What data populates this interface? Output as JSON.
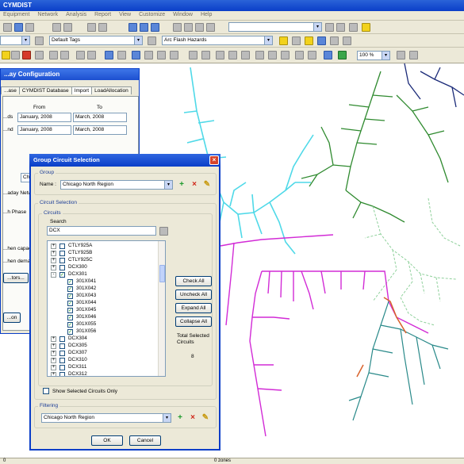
{
  "app": {
    "title": "CYMDIST",
    "menu": [
      "Equipment",
      "Network",
      "Analysis",
      "Report",
      "View",
      "Customize",
      "Window",
      "Help"
    ]
  },
  "toolbar": {
    "tags_combo": "Default Tags",
    "hazard_combo": "Arc Flash Hazards",
    "zoom_combo": "100 %"
  },
  "background_dialog": {
    "title": "...ay Configuration",
    "tabs": [
      "...ase",
      "CYMDIST Database",
      "Import",
      "LoadAllocation"
    ],
    "from_label": "From",
    "to_label": "To",
    "row1_label": "...ds",
    "row2_label": "...nd",
    "row1_from": "January, 2008",
    "row1_to": "March, 2008",
    "row2_from": "January, 2008",
    "row2_to": "March, 2008",
    "chica_field": "Chica...",
    "network_label": "...aday Network",
    "phase_label": "...h Phase",
    "capacity_label": "...hen capacity",
    "demands_label": "...hen demands",
    "tors_button": "...tors...",
    "bottom_button": "...on"
  },
  "dialog": {
    "title": "Group Circuit Selection",
    "group_label": "Group",
    "name_label": "Name :",
    "name_value": "Chicago North Region",
    "circuit_selection_label": "Circuit Selection",
    "circuits_label": "Circuits",
    "search_label": "Search",
    "search_value": "DCX",
    "tree": [
      {
        "label": "CTLY925A",
        "expander": "+",
        "checked": false,
        "indent": 0
      },
      {
        "label": "CTLY925B",
        "expander": "+",
        "checked": false,
        "indent": 0
      },
      {
        "label": "CTLY925C",
        "expander": "+",
        "checked": false,
        "indent": 0
      },
      {
        "label": "DCX300",
        "expander": "+",
        "checked": false,
        "indent": 0
      },
      {
        "label": "DCX301",
        "expander": "-",
        "checked": true,
        "indent": 0
      },
      {
        "label": "301X041",
        "expander": "",
        "checked": true,
        "indent": 1
      },
      {
        "label": "301X042",
        "expander": "",
        "checked": true,
        "indent": 1
      },
      {
        "label": "301X043",
        "expander": "",
        "checked": true,
        "indent": 1
      },
      {
        "label": "301X044",
        "expander": "",
        "checked": true,
        "indent": 1
      },
      {
        "label": "301X045",
        "expander": "",
        "checked": true,
        "indent": 1
      },
      {
        "label": "301X046",
        "expander": "",
        "checked": true,
        "indent": 1
      },
      {
        "label": "301X055",
        "expander": "",
        "checked": true,
        "indent": 1
      },
      {
        "label": "301X056",
        "expander": "",
        "checked": true,
        "indent": 1
      },
      {
        "label": "DCX304",
        "expander": "+",
        "checked": false,
        "indent": 0
      },
      {
        "label": "DCX305",
        "expander": "+",
        "checked": false,
        "indent": 0
      },
      {
        "label": "DCX307",
        "expander": "+",
        "checked": false,
        "indent": 0
      },
      {
        "label": "DCX310",
        "expander": "+",
        "checked": false,
        "indent": 0
      },
      {
        "label": "DCX311",
        "expander": "+",
        "checked": false,
        "indent": 0
      },
      {
        "label": "DCX312",
        "expander": "+",
        "checked": false,
        "indent": 0
      }
    ],
    "check_all": "Check All",
    "uncheck_all": "Uncheck All",
    "expand_all": "Expand All",
    "collapse_all": "Collapse All",
    "total_label": "Total Selected Circuits",
    "total_value": "8",
    "show_selected_label": "Show Selected Circuits Only",
    "filtering_label": "Filtering",
    "filtering_value": "Chicago North Region",
    "ok_button": "OK",
    "cancel_button": "Cancel"
  },
  "status": {
    "left": "0",
    "zones": "0 zones"
  },
  "colors": {
    "cyan_feeder": "#4fd9e8",
    "magenta_feeder": "#d22bd6",
    "green_feeder": "#2f8a2f",
    "light_green_feeder": "#8ed09a",
    "navy_feeder": "#1a2a78",
    "teal_feeder": "#2a8a8a"
  }
}
